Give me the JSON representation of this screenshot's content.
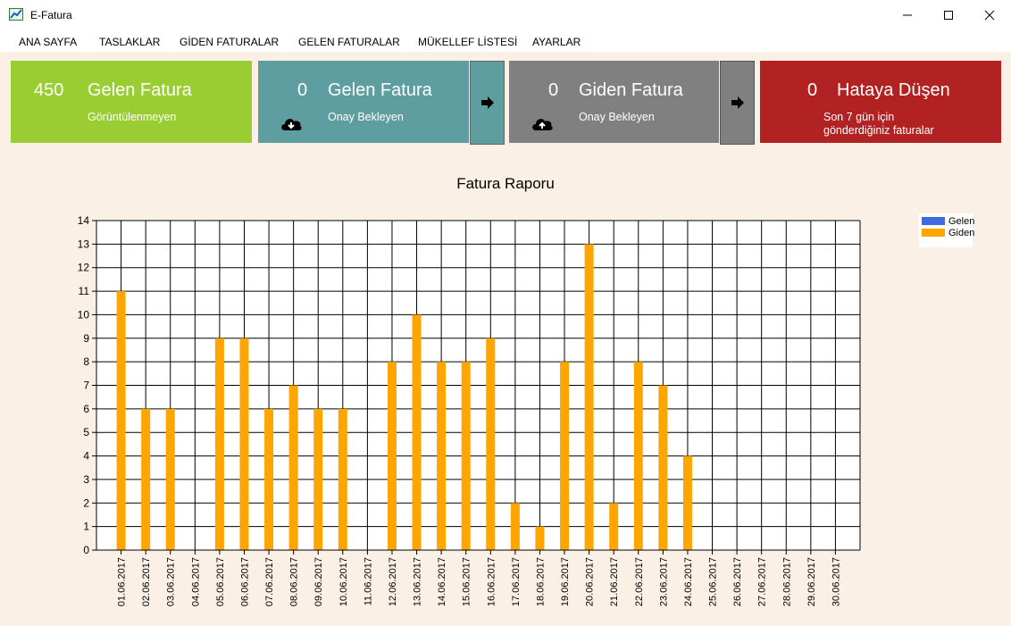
{
  "window": {
    "title": "E-Fatura",
    "icon": "chart-app-icon",
    "controls": [
      "minimize-icon",
      "maximize-icon",
      "close-icon"
    ]
  },
  "menu": {
    "items": [
      "ANA SAYFA",
      "TASLAKLAR",
      "GİDEN FATURALAR",
      "GELEN FATURALAR",
      "MÜKELLEF LİSTESİ",
      "AYARLAR"
    ]
  },
  "cards": {
    "incoming_unviewed": {
      "count": "450",
      "title": "Gelen Fatura",
      "subtitle": "Görüntülenmeyen",
      "color": "#9acd32"
    },
    "incoming_pending": {
      "count": "0",
      "title": "Gelen Fatura",
      "subtitle": "Onay Bekleyen",
      "color": "#5f9ea0",
      "icon": "cloud-download-icon",
      "arrow_icon": "arrow-right-icon"
    },
    "outgoing_pending": {
      "count": "0",
      "title": "Giden Fatura",
      "subtitle": "Onay Bekleyen",
      "color": "#808080",
      "icon": "cloud-upload-icon",
      "arrow_icon": "arrow-right-icon"
    },
    "errors": {
      "count": "0",
      "title": "Hataya Düşen",
      "subtitle_line1": "Son 7 gün için",
      "subtitle_line2": "gönderdiğiniz faturalar",
      "color": "#b22222"
    }
  },
  "chart_data": {
    "type": "bar",
    "title": "Fatura Raporu",
    "categories": [
      "01.06.2017",
      "02.06.2017",
      "03.06.2017",
      "04.06.2017",
      "05.06.2017",
      "06.06.2017",
      "07.06.2017",
      "08.06.2017",
      "09.06.2017",
      "10.06.2017",
      "11.06.2017",
      "12.06.2017",
      "13.06.2017",
      "14.06.2017",
      "15.06.2017",
      "16.06.2017",
      "17.06.2017",
      "18.06.2017",
      "19.06.2017",
      "20.06.2017",
      "21.06.2017",
      "22.06.2017",
      "23.06.2017",
      "24.06.2017",
      "25.06.2017",
      "26.06.2017",
      "27.06.2017",
      "28.06.2017",
      "29.06.2017",
      "30.06.2017"
    ],
    "series": [
      {
        "name": "Gelen",
        "color": "#4169e1",
        "values": [
          0,
          0,
          0,
          0,
          0,
          0,
          0,
          0,
          0,
          0,
          0,
          0,
          0,
          0,
          0,
          0,
          0,
          0,
          0,
          0,
          0,
          0,
          0,
          0,
          0,
          0,
          0,
          0,
          0,
          0
        ]
      },
      {
        "name": "Giden",
        "color": "#ffa500",
        "values": [
          11,
          6,
          6,
          0,
          9,
          9,
          6,
          7,
          6,
          6,
          0,
          8,
          10,
          8,
          8,
          9,
          2,
          1,
          8,
          13,
          2,
          8,
          7,
          4,
          0,
          0,
          0,
          0,
          0,
          0
        ]
      }
    ],
    "ylim": [
      0,
      14
    ],
    "yticks": [
      0,
      1,
      2,
      3,
      4,
      5,
      6,
      7,
      8,
      9,
      10,
      11,
      12,
      13,
      14
    ],
    "grid": true,
    "legend_position": "top-right"
  }
}
